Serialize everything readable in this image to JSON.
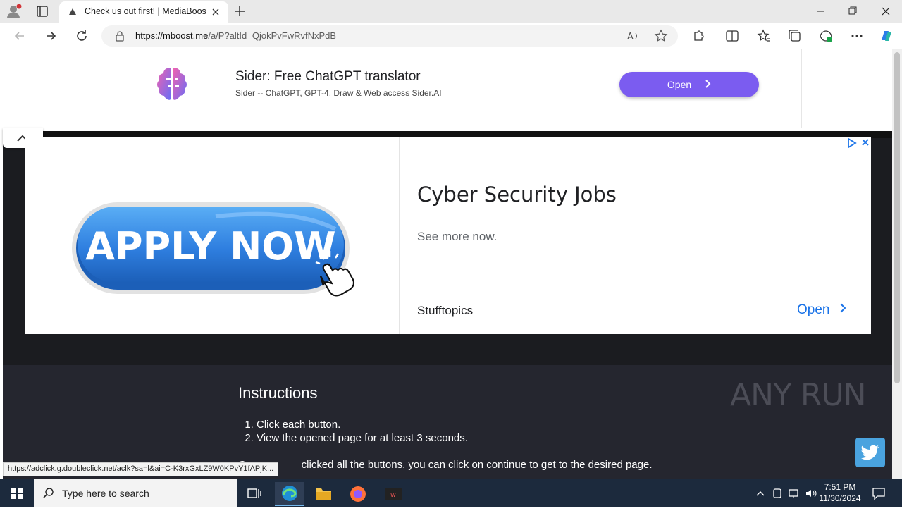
{
  "browser": {
    "tab_title": "Check us out first! | MediaBooster",
    "url_host": "https://mboost.me",
    "url_path": "/a/P?altId=QjokPvFwRvfNxPdB",
    "status_url": "https://adclick.g.doubleclick.net/aclk?sa=l&ai=C-K3rxGxLZ9W0KPvY1fAPjK..."
  },
  "ad_top": {
    "title": "Sider: Free ChatGPT translator",
    "subtitle": "Sider -- ChatGPT, GPT-4, Draw & Web access Sider.AI",
    "open_label": "Open"
  },
  "ad_main": {
    "image_text": "APPLY NOW",
    "headline": "Cyber Security Jobs",
    "description": "See more now.",
    "advertiser": "Stufftopics",
    "open_label": "Open"
  },
  "instructions": {
    "title": "Instructions",
    "steps": [
      "Click each button.",
      "View the opened page for at least 3 seconds."
    ],
    "note_start": "O",
    "note_rest": "clicked all the buttons, you can click on continue to get to the desired page."
  },
  "watermark": "ANY RUN",
  "taskbar": {
    "search_placeholder": "Type here to search",
    "time": "7:51 PM",
    "date": "11/30/2024"
  }
}
